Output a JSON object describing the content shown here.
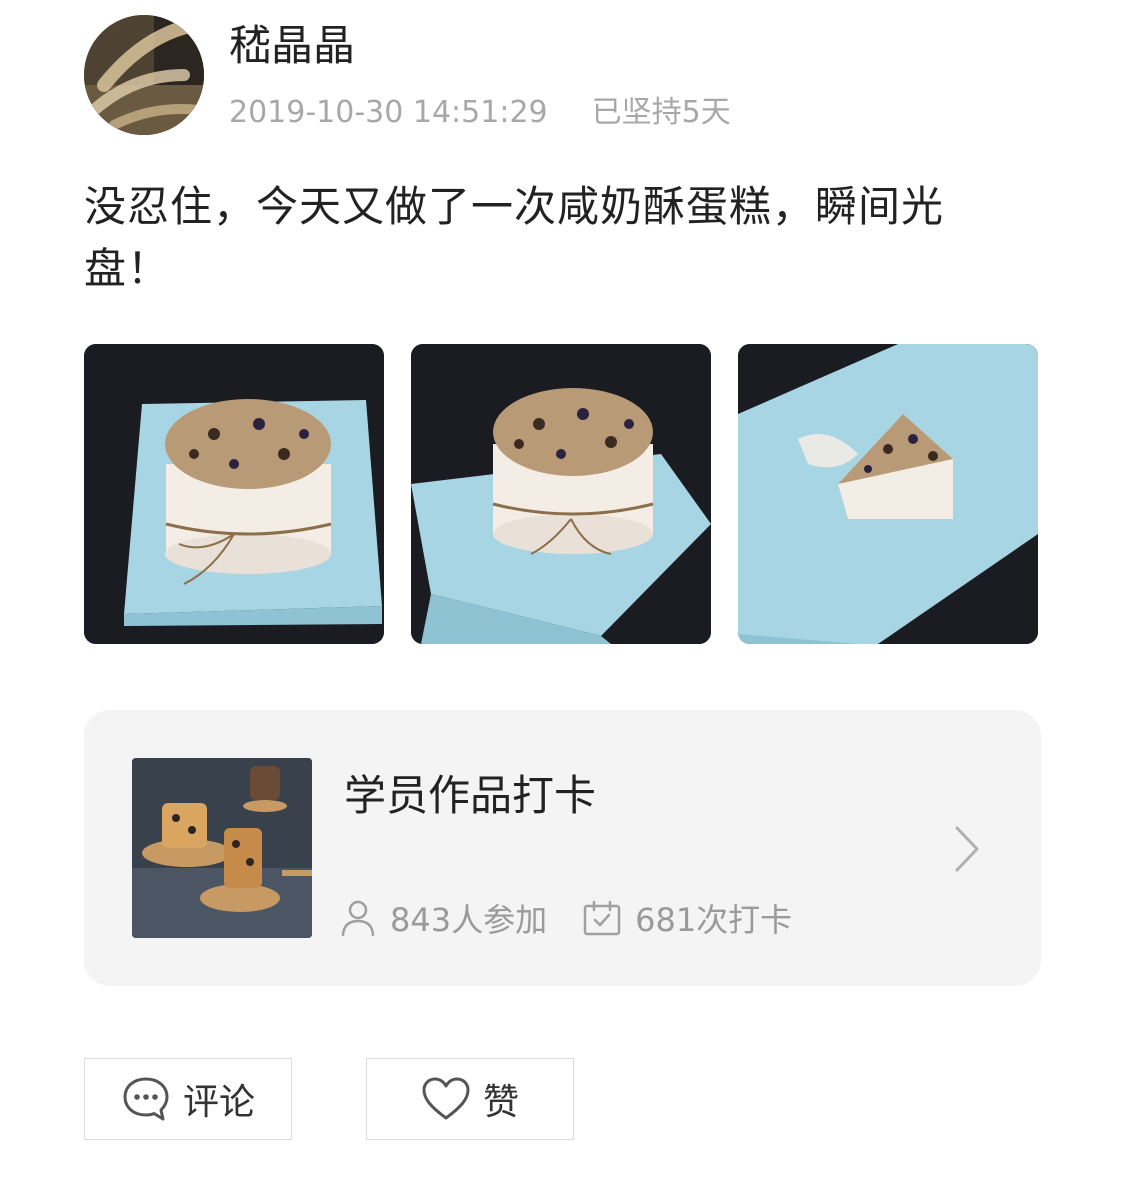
{
  "post": {
    "username": "嵇晶晶",
    "timestamp": "2019-10-30 14:51:29",
    "streak": "已坚持5天",
    "text": "没忍住，今天又做了一次咸奶酥蛋糕，瞬间光盘！"
  },
  "card": {
    "title": "学员作品打卡",
    "participants": "843人参加",
    "checkins": "681次打卡"
  },
  "actions": {
    "comment_label": "评论",
    "like_label": "赞"
  },
  "icons": {
    "person": "person-icon",
    "calendar": "calendar-check-icon",
    "chevron": "chevron-right-icon",
    "comment": "comment-bubble-icon",
    "like": "heart-icon"
  },
  "colors": {
    "meta_gray": "#a8a8a8",
    "card_background": "#f4f4f4",
    "board_blue": "#a9d7e5"
  }
}
